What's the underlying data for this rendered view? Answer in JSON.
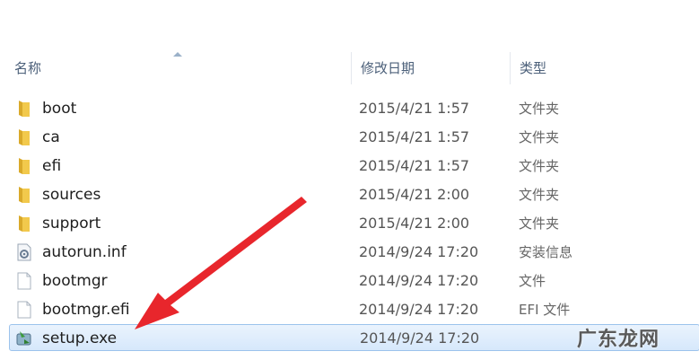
{
  "columns": {
    "name": "名称",
    "date": "修改日期",
    "type": "类型"
  },
  "files": [
    {
      "name": "boot",
      "date": "2015/4/21 1:57",
      "type": "文件夹",
      "icon": "folder-icon"
    },
    {
      "name": "ca",
      "date": "2015/4/21 1:57",
      "type": "文件夹",
      "icon": "folder-icon"
    },
    {
      "name": "efi",
      "date": "2015/4/21 1:57",
      "type": "文件夹",
      "icon": "folder-icon"
    },
    {
      "name": "sources",
      "date": "2015/4/21 2:00",
      "type": "文件夹",
      "icon": "folder-icon"
    },
    {
      "name": "support",
      "date": "2015/4/21 2:00",
      "type": "文件夹",
      "icon": "folder-icon"
    },
    {
      "name": "autorun.inf",
      "date": "2014/9/24 17:20",
      "type": "安装信息",
      "icon": "settings-file-icon"
    },
    {
      "name": "bootmgr",
      "date": "2014/9/24 17:20",
      "type": "文件",
      "icon": "blank-file-icon"
    },
    {
      "name": "bootmgr.efi",
      "date": "2014/9/24 17:20",
      "type": "EFI 文件",
      "icon": "blank-file-icon"
    },
    {
      "name": "setup.exe",
      "date": "2014/9/24 17:20",
      "type": "",
      "icon": "setup-exe-icon",
      "selected": true
    }
  ],
  "watermark": "广东龙网",
  "colors": {
    "annotation_arrow": "#e8262c",
    "folder": "#e8b93c",
    "selection": "#d6e8fb"
  }
}
